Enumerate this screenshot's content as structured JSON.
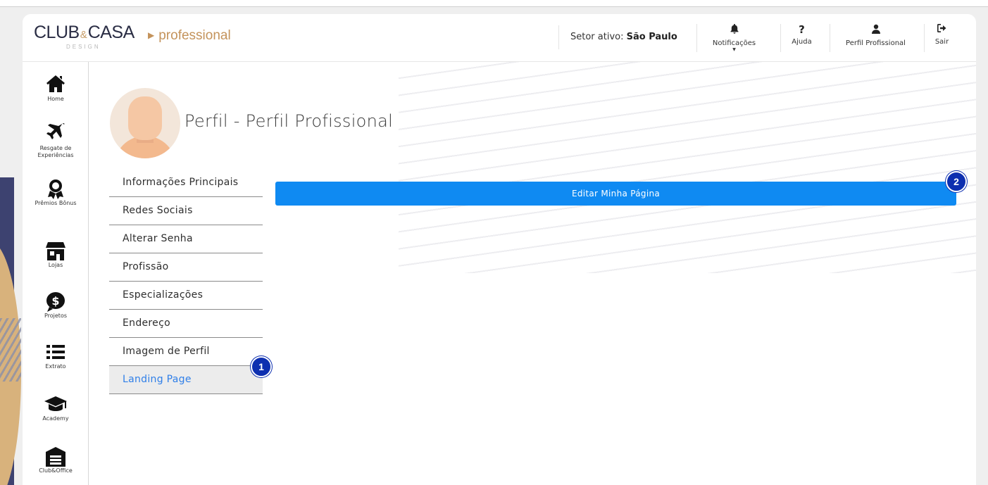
{
  "header": {
    "brand_word_1": "CLUB",
    "brand_amp": "&",
    "brand_word_2": "CASA",
    "brand_design": "DESIGN",
    "brand_sub": "professional",
    "sector_label": "Setor ativo:",
    "sector_value": "São Paulo",
    "buttons": [
      {
        "label": "Notificações",
        "icon": "bell-icon"
      },
      {
        "label": "Ajuda",
        "icon": "question-icon"
      },
      {
        "label": "Perfil Profissional",
        "icon": "user-icon"
      },
      {
        "label": "Sair",
        "icon": "logout-icon"
      }
    ]
  },
  "sidebar": {
    "items": [
      {
        "label": "Home",
        "icon": "home-icon"
      },
      {
        "label": "Resgate de Experiências",
        "icon": "plane-icon"
      },
      {
        "label": "Prêmios Bônus",
        "icon": "award-icon"
      },
      {
        "label": "Lojas",
        "icon": "store-icon"
      },
      {
        "label": "Projetos",
        "icon": "dollar-chat-icon"
      },
      {
        "label": "Extrato",
        "icon": "list-icon"
      },
      {
        "label": "Academy",
        "icon": "graduation-cap-icon"
      },
      {
        "label": "Club&Office",
        "icon": "warehouse-icon"
      }
    ]
  },
  "main": {
    "page_title": "Perfil - Perfil Profissional",
    "submenu": [
      "Informações Principais",
      "Redes Sociais",
      "Alterar Senha",
      "Profissão",
      "Especializações",
      "Endereço",
      "Imagem de Perfil",
      "Landing Page"
    ],
    "active_item": "Landing Page",
    "edit_button": "Editar Minha Página"
  },
  "annotations": {
    "badge_1": "1",
    "badge_2": "2"
  },
  "colors": {
    "accent": "#0f8af2",
    "active_text": "#2f7fe8",
    "brand_gold": "#c4935b",
    "badge": "#0d2fb0"
  }
}
